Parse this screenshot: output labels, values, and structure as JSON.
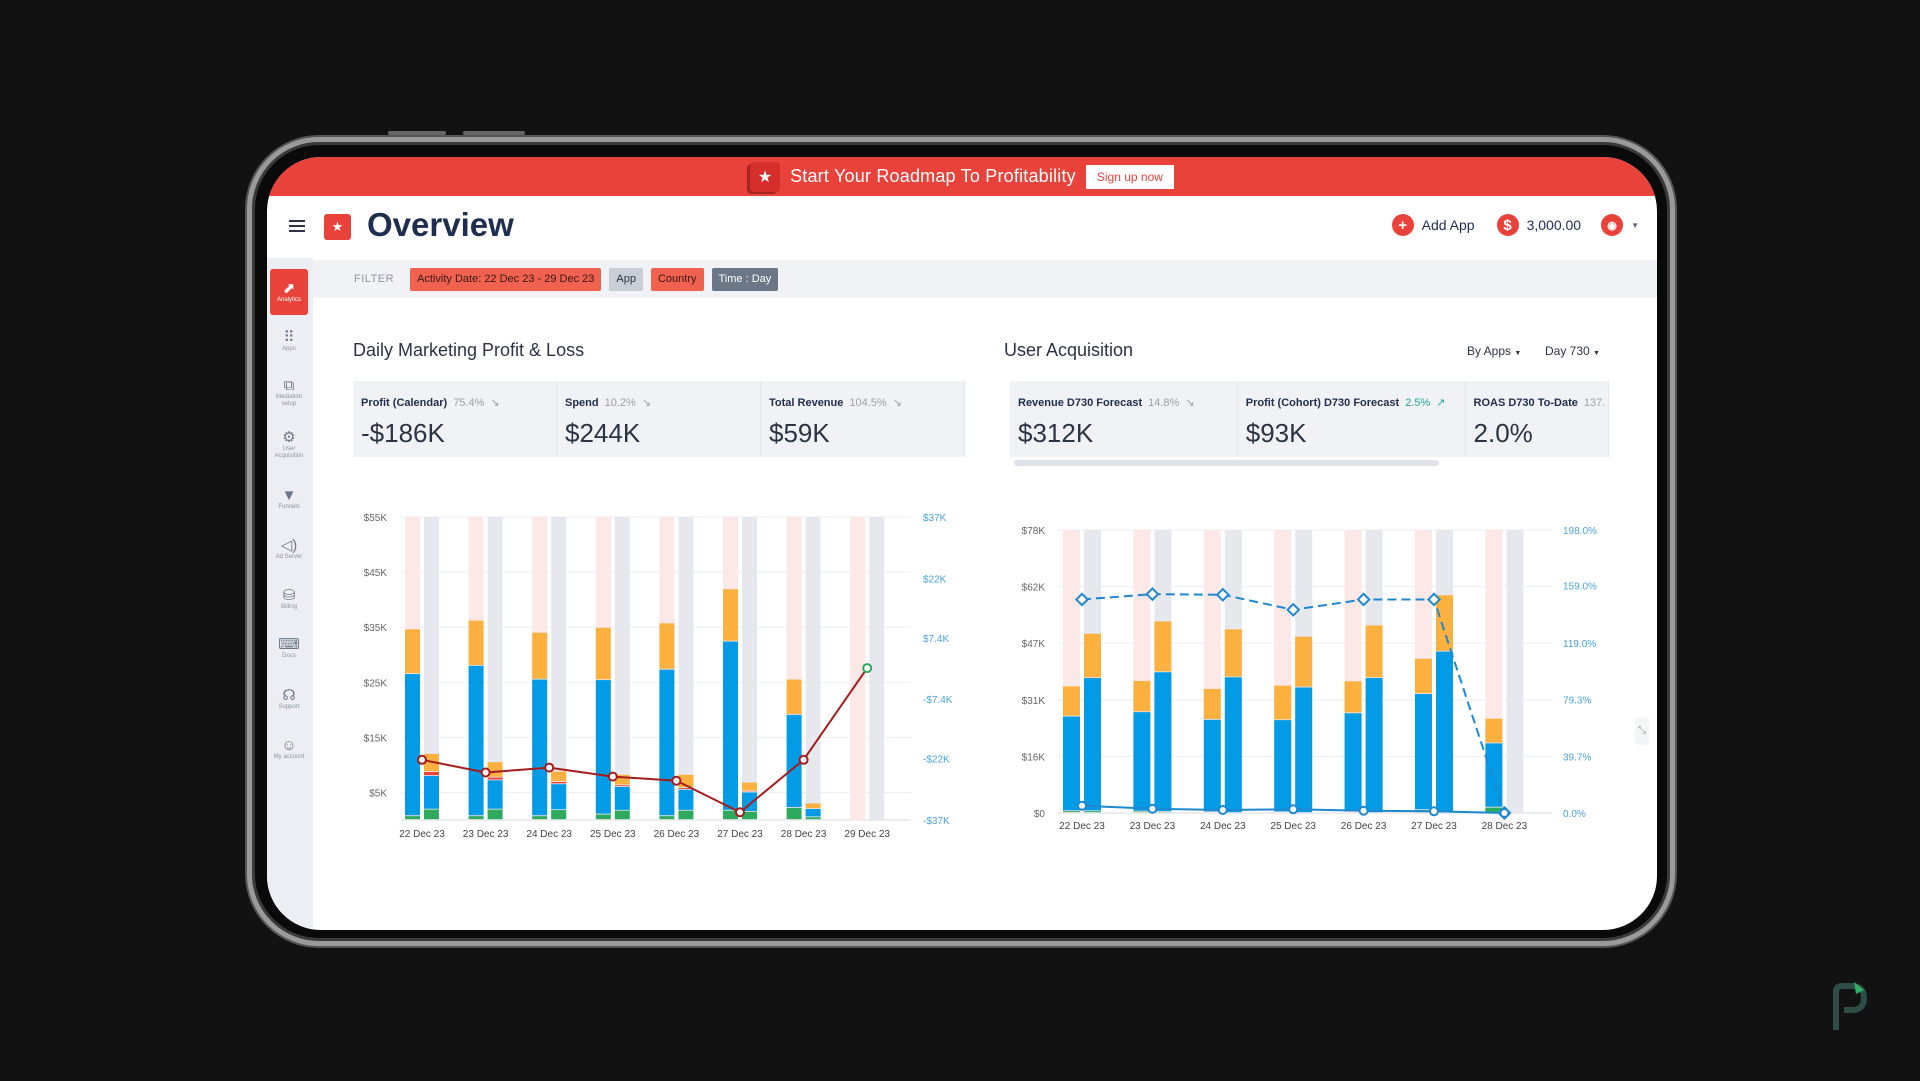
{
  "banner": {
    "text": "Start Your Roadmap To Profitability",
    "button": "Sign up now"
  },
  "header": {
    "title": "Overview",
    "add_app": "Add App",
    "balance": "3,000.00"
  },
  "sidebar": {
    "items": [
      {
        "label": "Analytics",
        "icon": "chart-icon",
        "active": true
      },
      {
        "label": "Apps",
        "icon": "grid-dots-icon"
      },
      {
        "label": "Mediation setup",
        "icon": "mediation-icon"
      },
      {
        "label": "User Acquisition",
        "icon": "network-icon"
      },
      {
        "label": "Funnels",
        "icon": "funnel-icon"
      },
      {
        "label": "Ad Server",
        "icon": "megaphone-icon"
      },
      {
        "label": "Billing",
        "icon": "billing-icon"
      },
      {
        "label": "Docs",
        "icon": "code-doc-icon"
      },
      {
        "label": "Support",
        "icon": "headset-icon"
      },
      {
        "label": "My account",
        "icon": "user-icon"
      }
    ]
  },
  "filter": {
    "label": "FILTER",
    "chips": [
      {
        "label": "Activity Date: 22 Dec 23 - 29 Dec 23",
        "bg": "#f0614f",
        "fg": "#3a1a16"
      },
      {
        "label": "App",
        "bg": "#c9cdd5",
        "fg": "#2b3445"
      },
      {
        "label": "Country",
        "bg": "#f0614f",
        "fg": "#3a1a16"
      },
      {
        "label": "Time : Day",
        "bg": "#6b7686",
        "fg": "#ffffff"
      }
    ]
  },
  "pnl": {
    "title": "Daily Marketing Profit & Loss",
    "kpis": [
      {
        "label": "Profit (Calendar)",
        "pct": "75.4%",
        "trend": "down",
        "value": "-$186K"
      },
      {
        "label": "Spend",
        "pct": "10.2%",
        "trend": "down",
        "value": "$244K"
      },
      {
        "label": "Total Revenue",
        "pct": "104.5%",
        "trend": "down",
        "value": "$59K"
      }
    ]
  },
  "ua": {
    "title": "User Acquisition",
    "dropdown_group": "By Apps",
    "dropdown_day": "Day 730",
    "kpis": [
      {
        "label": "Revenue D730 Forecast",
        "pct": "14.8%",
        "trend": "down",
        "value": "$312K"
      },
      {
        "label": "Profit (Cohort) D730 Forecast",
        "pct": "2.5%",
        "trend": "up",
        "value": "$93K"
      },
      {
        "label": "ROAS D730 To-Date",
        "pct": "137.",
        "trend": "",
        "value": "2.0%"
      }
    ]
  },
  "colors": {
    "brand": "#e8423a",
    "blue": "#039be5",
    "orange": "#fbb040",
    "green": "#2eaa5e",
    "profit_line": "#a61c1c",
    "axis_right": "#4aa3d8"
  },
  "chart_data": [
    {
      "type": "bar",
      "grid": true,
      "categories": [
        "22 Dec 23",
        "23 Dec 23",
        "24 Dec 23",
        "25 Dec 23",
        "26 Dec 23",
        "27 Dec 23",
        "28 Dec 23",
        "29 Dec 23"
      ],
      "y_left": {
        "ticks": [
          "$5K",
          "$15K",
          "$25K",
          "$35K",
          "$45K",
          "$55K"
        ],
        "tick_values": [
          5,
          15,
          25,
          35,
          45,
          55
        ],
        "range": [
          0,
          55
        ],
        "unit": "$K"
      },
      "y_right": {
        "ticks": [
          "-$37K",
          "-$22K",
          "-$7.4K",
          "$7.4K",
          "$22K",
          "$37K"
        ],
        "tick_values": [
          -37,
          -22,
          -7.4,
          7.4,
          22,
          37
        ],
        "range": [
          -37,
          37
        ],
        "unit": "$K"
      },
      "stacks": [
        {
          "background": "#fde8e8",
          "segments": [
            {
              "color": "#2eaa5e",
              "values": [
                0.7,
                0.7,
                0.7,
                1.0,
                0.7,
                1.7,
                2.2,
                0
              ]
            },
            {
              "color": "#039be5",
              "values": [
                25.8,
                27.3,
                24.8,
                24.4,
                26.6,
                30.7,
                16.9,
                0
              ]
            },
            {
              "color": "#fbb040",
              "values": [
                8.1,
                8.2,
                8.5,
                9.5,
                8.4,
                9.5,
                6.4,
                0
              ]
            }
          ]
        },
        {
          "background": "#e6e8ee",
          "segments": [
            {
              "color": "#2eaa5e",
              "values": [
                1.9,
                1.9,
                1.8,
                1.7,
                1.7,
                1.5,
                0.5,
                0
              ]
            },
            {
              "color": "#039be5",
              "values": [
                6.1,
                5.3,
                4.7,
                4.3,
                3.8,
                3.5,
                1.5,
                0
              ]
            },
            {
              "color": "#e8423a",
              "values": [
                0.7,
                0.5,
                0.4,
                0.3,
                0.3,
                0.2,
                0,
                0
              ]
            },
            {
              "color": "#fbb040",
              "values": [
                3.3,
                2.8,
                1.9,
                1.9,
                2.4,
                1.6,
                1.0,
                0
              ]
            }
          ]
        }
      ],
      "lines": [
        {
          "axis": "right",
          "color": "#a61c1c",
          "dashed": false,
          "values": [
            -22.3,
            -25.4,
            -24.2,
            -26.4,
            -27.4,
            -35.1,
            -22.3,
            0.1
          ],
          "last_marker_color": "#2eaa5e"
        }
      ]
    },
    {
      "type": "bar",
      "grid": true,
      "categories": [
        "22 Dec 23",
        "23 Dec 23",
        "24 Dec 23",
        "25 Dec 23",
        "26 Dec 23",
        "27 Dec 23",
        "28 Dec 23"
      ],
      "y_left": {
        "ticks": [
          "$0",
          "$16K",
          "$31K",
          "$47K",
          "$62K",
          "$78K"
        ],
        "tick_values": [
          0,
          15.6,
          31.2,
          46.8,
          62.4,
          78
        ],
        "range": [
          0,
          78
        ],
        "unit": "$K"
      },
      "y_right": {
        "ticks": [
          "0.0%",
          "39.7%",
          "79.3%",
          "119.0%",
          "159.0%",
          "198.0%"
        ],
        "tick_values": [
          0,
          39.7,
          79.3,
          119,
          159,
          198
        ],
        "range": [
          0,
          198
        ],
        "unit": "%"
      },
      "stacks": [
        {
          "background": "#fde8e8",
          "segments": [
            {
              "color": "#2eaa5e",
              "values": [
                0.5,
                0.4,
                0.2,
                0.2,
                0.2,
                0.8,
                1.5
              ]
            },
            {
              "color": "#039be5",
              "values": [
                26.1,
                27.4,
                25.5,
                25.4,
                27.3,
                32.0,
                17.7
              ]
            },
            {
              "color": "#fbb040",
              "values": [
                8.3,
                8.6,
                8.5,
                9.5,
                8.8,
                9.7,
                6.8
              ]
            }
          ]
        },
        {
          "background": "#e6e8ee",
          "segments": [
            {
              "color": "#2eaa5e",
              "values": [
                0.5,
                0.3,
                0,
                0,
                0,
                0.3,
                0
              ]
            },
            {
              "color": "#039be5",
              "values": [
                36.7,
                38.5,
                37.4,
                34.6,
                37.2,
                44.2,
                0
              ]
            },
            {
              "color": "#fbb040",
              "values": [
                12.2,
                14.0,
                13.2,
                14.0,
                14.5,
                15.5,
                0
              ]
            }
          ]
        }
      ],
      "lines": [
        {
          "axis": "right",
          "color": "#1e88d0",
          "dashed": true,
          "marker": "diamond",
          "values": [
            149.4,
            153.1,
            152.7,
            142.2,
            149.4,
            149.4,
            0
          ]
        },
        {
          "axis": "right",
          "color": "#1e88d0",
          "dashed": false,
          "marker": "circle",
          "values": [
            5.1,
            3.0,
            2.1,
            2.6,
            1.6,
            1.2,
            0
          ]
        }
      ]
    }
  ]
}
